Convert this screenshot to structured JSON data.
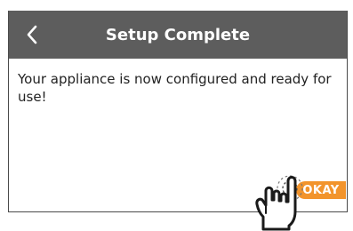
{
  "header": {
    "back_icon": "chevron-left-icon",
    "title": "Setup Complete"
  },
  "main": {
    "message": "Your appliance is now configured and ready for use!"
  },
  "actions": {
    "okay_label": "OKAY"
  },
  "overlay": {
    "icon": "tap-gesture-hand-icon"
  },
  "colors": {
    "header_bg": "#5d5d5d",
    "accent": "#f2942c",
    "text": "#222222"
  }
}
